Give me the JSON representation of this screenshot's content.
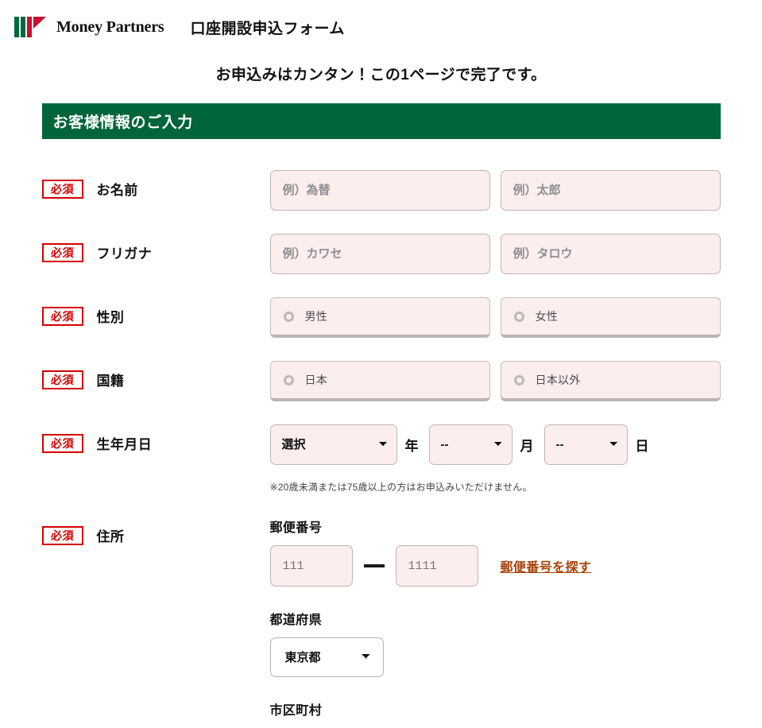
{
  "header": {
    "brand_name": "Money Partners",
    "logo_icon": "money-partners-logo",
    "title": "口座開設申込フォーム"
  },
  "lead": "お申込みはカンタン！この1ページで完了です。",
  "section": {
    "title": "お客様情報のご入力",
    "banner_color": "#00653a"
  },
  "badges": {
    "required": "必須",
    "required_color": "#d50000"
  },
  "fields": {
    "name": {
      "label": "お名前",
      "last_placeholder": "例）為替",
      "last_value": "",
      "first_placeholder": "例）太郎",
      "first_value": ""
    },
    "furigana": {
      "label": "フリガナ",
      "last_placeholder": "例）カワセ",
      "last_value": "",
      "first_placeholder": "例）タロウ",
      "first_value": ""
    },
    "gender": {
      "label": "性別",
      "options": [
        "男性",
        "女性"
      ],
      "selected": ""
    },
    "nationality": {
      "label": "国籍",
      "options": [
        "日本",
        "日本以外"
      ],
      "selected": ""
    },
    "birthdate": {
      "label": "生年月日",
      "year_value": "選択",
      "year_unit": "年",
      "month_value": "--",
      "month_unit": "月",
      "day_value": "--",
      "day_unit": "日",
      "note": "※20歳未満または75歳以上の方はお申込みいただけません。"
    },
    "address": {
      "label": "住所",
      "zip_label": "郵便番号",
      "zip_first_placeholder": "111",
      "zip_first_value": "",
      "zip_second_placeholder": "1111",
      "zip_second_value": "",
      "zip_search_link": "郵便番号を探す",
      "zip_link_color": "#a8420a",
      "prefecture_label": "都道府県",
      "prefecture_value": "東京都",
      "city_label": "市区町村"
    }
  }
}
